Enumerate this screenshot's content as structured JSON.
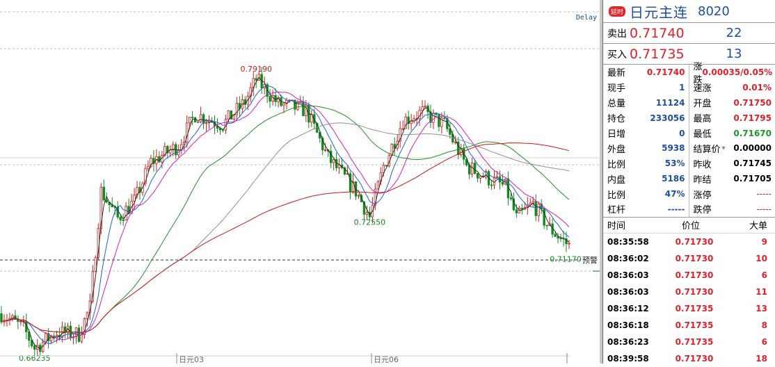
{
  "chart": {
    "delay_label": "Delay",
    "alert_label": "预警",
    "high_label": "0.79190",
    "low_label": "0.66235",
    "mid_low_label": "0.72550",
    "last_low_label": "0.71170",
    "x_labels": [
      "日元03",
      "日元06"
    ]
  },
  "chart_data": {
    "type": "candlestick",
    "ylim": [
      0.655,
      0.83
    ],
    "alert_level": 0.7255,
    "annotated_points": [
      {
        "label": "0.79190",
        "value": 0.7919
      },
      {
        "label": "0.66235",
        "value": 0.66235
      },
      {
        "label": "0.72550",
        "value": 0.7255
      },
      {
        "label": "0.71170",
        "value": 0.7117
      }
    ],
    "x_ticks": [
      "日元03",
      "日元06"
    ],
    "series": [
      {
        "color": "#2a2a2a"
      },
      {
        "color": "#2060d0"
      },
      {
        "color": "#d020c0"
      },
      {
        "color": "#20902a"
      },
      {
        "color": "#909090"
      },
      {
        "color": "#c81818"
      }
    ]
  },
  "panel": {
    "badge": "延时",
    "name": "日元主连",
    "code": "8020",
    "ask": {
      "label": "卖出",
      "price": "0.71740",
      "volume": "22"
    },
    "bid": {
      "label": "买入",
      "price": "0.71735",
      "volume": "13"
    },
    "left_stats": [
      {
        "k": "最新",
        "v": "0.71740",
        "c": "red"
      },
      {
        "k": "现手",
        "v": "1",
        "c": "blue"
      },
      {
        "k": "总量",
        "v": "11124",
        "c": "blue"
      },
      {
        "k": "持仓",
        "v": "233056",
        "c": "blue"
      },
      {
        "k": "日增",
        "v": "0",
        "c": "blue"
      },
      {
        "k": "外盘",
        "v": "5938",
        "c": "blue"
      },
      {
        "k": "比例",
        "v": "53%",
        "c": "blue"
      },
      {
        "k": "内盘",
        "v": "5186",
        "c": "blue"
      },
      {
        "k": "比例",
        "v": "47%",
        "c": "blue"
      },
      {
        "k": "杠杆",
        "v": "-----",
        "c": "blue"
      }
    ],
    "right_stats": [
      {
        "k": "涨跌",
        "v": "0.00035/0.05%",
        "c": "red"
      },
      {
        "k": "速涨",
        "v": "0.01%",
        "c": "red"
      },
      {
        "k": "开盘",
        "v": "0.71750",
        "c": "red"
      },
      {
        "k": "最高",
        "v": "0.71795",
        "c": "red"
      },
      {
        "k": "最低",
        "v": "0.71670",
        "c": "green"
      },
      {
        "k": "结算价",
        "v": "0.00000",
        "c": "black"
      },
      {
        "k": "昨收",
        "v": "0.71745",
        "c": "black"
      },
      {
        "k": "昨结",
        "v": "0.71705",
        "c": "black"
      },
      {
        "k": "涨停",
        "v": "-----",
        "c": "dash"
      },
      {
        "k": "跌停",
        "v": "-----",
        "c": "dash"
      }
    ],
    "ticks_header": {
      "time": "时间",
      "price": "价位",
      "size": "大单"
    },
    "ticks": [
      {
        "time": "08:35:58",
        "price": "0.71730",
        "size": "9"
      },
      {
        "time": "08:36:02",
        "price": "0.71730",
        "size": "10"
      },
      {
        "time": "08:36:03",
        "price": "0.71730",
        "size": "6"
      },
      {
        "time": "08:36:03",
        "price": "0.71730",
        "size": "11"
      },
      {
        "time": "08:36:12",
        "price": "0.71735",
        "size": "13"
      },
      {
        "time": "08:36:18",
        "price": "0.71735",
        "size": "8"
      },
      {
        "time": "08:36:23",
        "price": "0.71735",
        "size": "6"
      },
      {
        "time": "08:39:58",
        "price": "0.71730",
        "size": "18"
      }
    ]
  }
}
